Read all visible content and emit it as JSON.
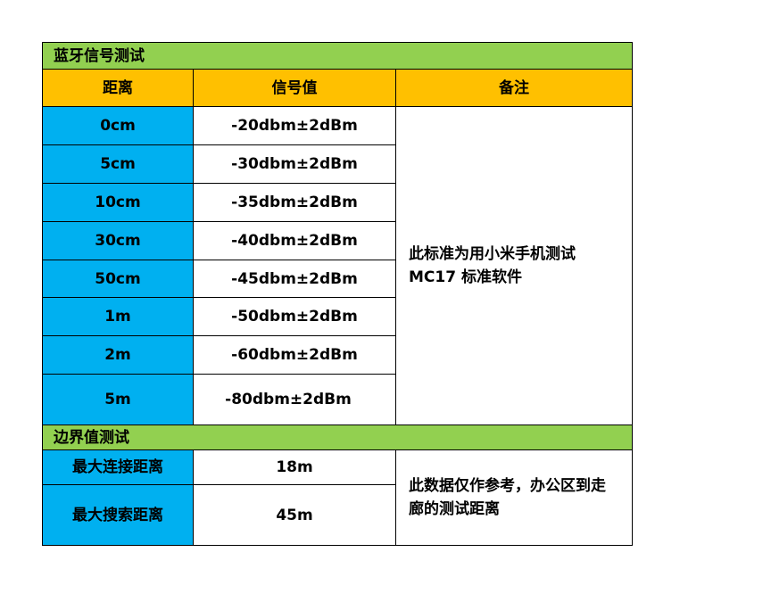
{
  "sections": {
    "bluetooth_title": "蓝牙信号测试",
    "boundary_title": "边界值测试"
  },
  "headers": {
    "distance": "距离",
    "signal": "信号值",
    "remark": "备注"
  },
  "bluetooth_rows": [
    {
      "distance": "0cm",
      "signal": "-20dbm±2dBm"
    },
    {
      "distance": "5cm",
      "signal": "-30dbm±2dBm"
    },
    {
      "distance": "10cm",
      "signal": "-35dbm±2dBm"
    },
    {
      "distance": "30cm",
      "signal": "-40dbm±2dBm"
    },
    {
      "distance": "50cm",
      "signal": "-45dbm±2dBm"
    },
    {
      "distance": "1m",
      "signal": "-50dbm±2dBm"
    },
    {
      "distance": "2m",
      "signal": "-60dbm±2dBm"
    },
    {
      "distance": "5m",
      "signal": "-80dbm±2dBm"
    }
  ],
  "bluetooth_remark": "此标准为用小米手机测试MC17 标准软件",
  "boundary_rows": [
    {
      "label": "最大连接距离",
      "value": "18m"
    },
    {
      "label": "最大搜索距离",
      "value": "45m"
    }
  ],
  "boundary_remark": "此数据仅作参考，办公区到走廊的测试距离",
  "colors": {
    "section_bg": "#92d050",
    "header_bg": "#ffc000",
    "label_bg": "#00b0f0",
    "grid_line": "#000000"
  }
}
